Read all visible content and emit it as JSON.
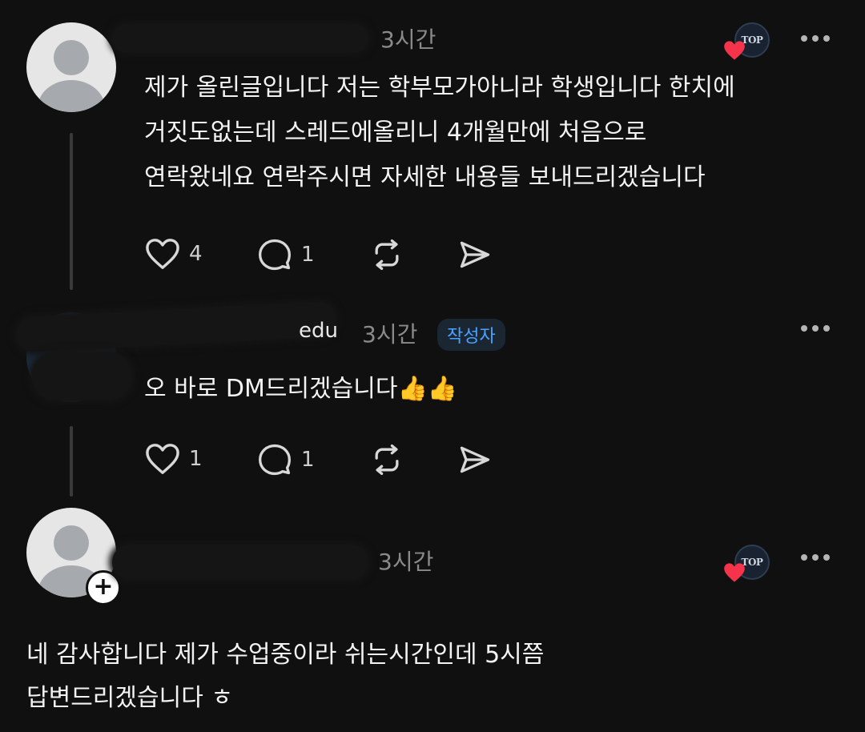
{
  "posts": [
    {
      "time": "3시간",
      "text_lines": [
        "제가 올린글입니다 저는 학부모가아니라 학생입니다 한치에",
        "거짓도없는데 스레드에올리니 4개월만에 처음으로",
        "연락왔네요 연락주시면 자세한 내용들 보내드리겠습니다"
      ],
      "likes": "4",
      "replies": "1",
      "logo_text": "TOP"
    },
    {
      "username_tail": "edu",
      "time": "3시간",
      "badge": "작성자",
      "text": "오 바로 DM드리겠습니다",
      "emoji": "👍👍",
      "likes": "1",
      "replies": "1"
    },
    {
      "time": "3시간",
      "text_lines": [
        "네 감사합니다 제가 수업중이라 쉬는시간인데 5시쯤",
        "답변드리겠습니다 ㅎ"
      ],
      "logo_text": "TOP",
      "follow_symbol": "+"
    }
  ],
  "icons": {
    "like": "heart-outline-icon",
    "reply": "comment-bubble-icon",
    "repost": "repost-icon",
    "share": "send-icon",
    "more": "more-dots-icon"
  }
}
